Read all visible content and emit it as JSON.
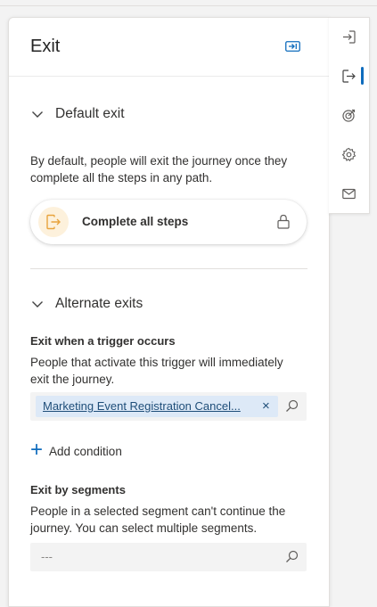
{
  "panel": {
    "title": "Exit"
  },
  "default_exit": {
    "heading": "Default exit",
    "description": "By default, people will exit the journey once they complete all the steps in any path.",
    "step_label": "Complete all steps"
  },
  "alternate_exits": {
    "heading": "Alternate exits",
    "trigger": {
      "label": "Exit when a trigger occurs",
      "description": "People that activate this trigger will immediately exit the journey.",
      "selected_tag": "Marketing Event Registration Cancel...",
      "remove_glyph": "×"
    },
    "add_condition_label": "Add condition",
    "segments": {
      "label": "Exit by segments",
      "description": "People in a selected segment can't continue the journey. You can select multiple segments.",
      "placeholder": "---"
    }
  },
  "rail": {
    "items": [
      {
        "icon": "sign-in-icon",
        "active": false
      },
      {
        "icon": "sign-out-icon",
        "active": true
      },
      {
        "icon": "goal-target-icon",
        "active": false
      },
      {
        "icon": "gear-icon",
        "active": false
      },
      {
        "icon": "mail-icon",
        "active": false
      }
    ]
  },
  "colors": {
    "accent": "#0f6cbd",
    "tag_bg": "#dde9f7",
    "tag_text": "#1f4e79",
    "step_icon_bg": "#fdf1dc",
    "step_icon": "#e8a33d"
  }
}
